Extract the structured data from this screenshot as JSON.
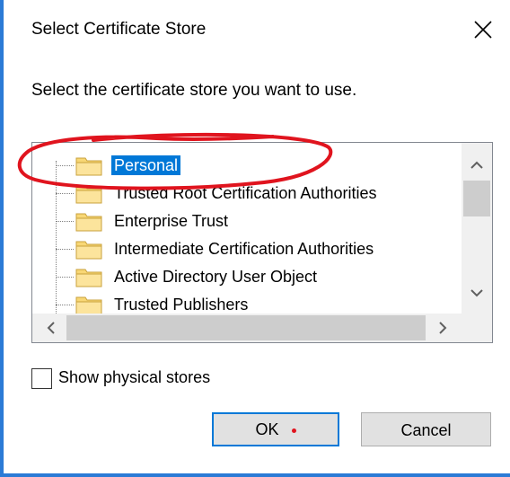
{
  "dialog": {
    "title": "Select Certificate Store",
    "prompt": "Select the certificate store you want to use.",
    "close_icon": "close-icon"
  },
  "tree": {
    "items": [
      {
        "label": "Personal",
        "selected": true
      },
      {
        "label": "Trusted Root Certification Authorities",
        "selected": false
      },
      {
        "label": "Enterprise Trust",
        "selected": false
      },
      {
        "label": "Intermediate Certification Authorities",
        "selected": false
      },
      {
        "label": "Active Directory User Object",
        "selected": false
      },
      {
        "label": "Trusted Publishers",
        "selected": false
      }
    ],
    "folder_icon": "folder-icon"
  },
  "options": {
    "show_physical_stores_label": "Show physical stores",
    "show_physical_stores_checked": false
  },
  "buttons": {
    "ok_label": "OK",
    "cancel_label": "Cancel"
  },
  "colors": {
    "selection": "#0078d7",
    "annotation": "#e0141e",
    "accent": "#2b7bd6"
  }
}
